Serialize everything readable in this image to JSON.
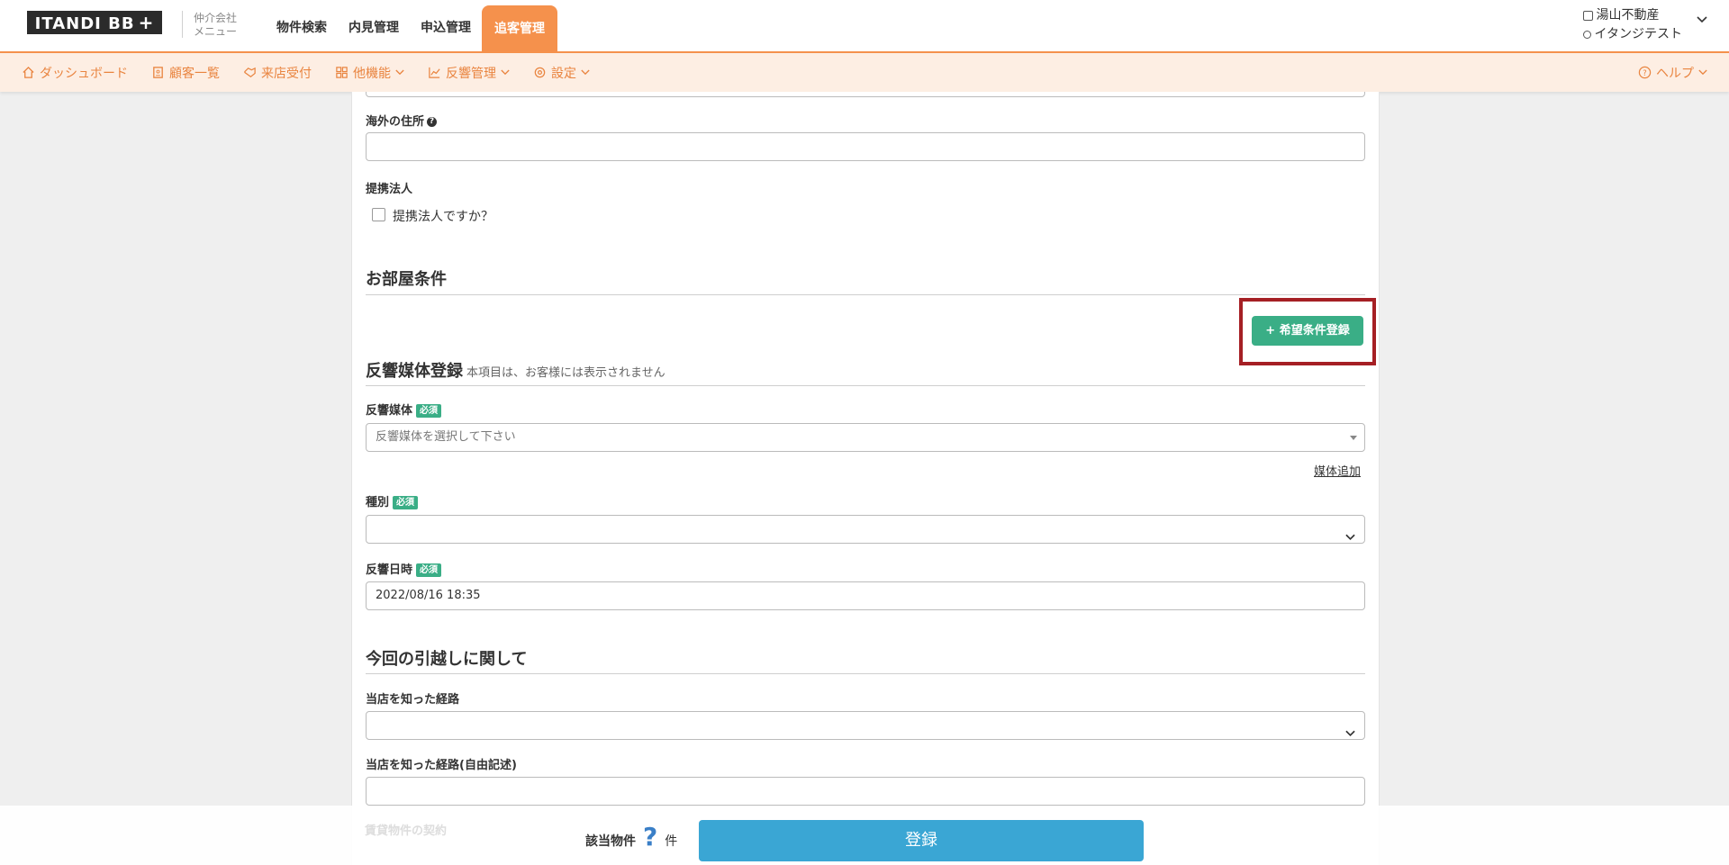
{
  "header": {
    "logo": "ITANDI BB",
    "logo_plus": "+",
    "broker_menu_line1": "仲介会社",
    "broker_menu_line2": "メニュー",
    "nav": [
      "物件検索",
      "内見管理",
      "申込管理",
      "追客管理"
    ],
    "active_nav": "追客管理",
    "company": "湯山不動産",
    "user": "イタンジテスト"
  },
  "subnav": {
    "items": [
      "ダッシュボード",
      "顧客一覧",
      "来店受付",
      "他機能",
      "反響管理",
      "設定"
    ],
    "help": "ヘルプ"
  },
  "form": {
    "overseas_address_label": "海外の住所",
    "partner_label": "提携法人",
    "partner_checkbox": "提携法人ですか？",
    "room_conditions_title": "お部屋条件",
    "add_condition_button": "+ 希望条件登録",
    "media_title": "反響媒体登録",
    "media_note": "本項目は、お客様には表示されません",
    "media_label": "反響媒体",
    "required": "必須",
    "media_placeholder": "反響媒体を選択して下さい",
    "add_media_link": "媒体追加",
    "type_label": "種別",
    "date_label": "反響日時",
    "date_value": "2022/08/16 18:35",
    "moving_title": "今回の引越しに関して",
    "route_label": "当店を知った経路",
    "route_free_label": "当店を知った経路(自由記述)",
    "rental_contract_label": "賃貸物件の契約"
  },
  "bottom": {
    "count_label": "該当物件",
    "count_value": "?",
    "count_unit": "件",
    "submit": "登録"
  },
  "colors": {
    "accent": "#f5914c",
    "primary_button": "#3aa6d4",
    "success": "#3aae86",
    "highlight_border": "#a51f24"
  }
}
